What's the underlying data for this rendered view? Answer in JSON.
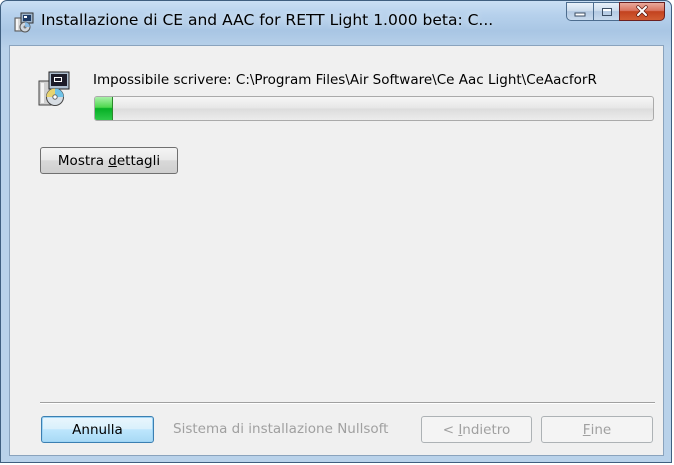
{
  "window": {
    "title": "Installazione di CE and AAC for RETT Light 1.000 beta: C...",
    "caption_buttons": {
      "minimize_icon": "minimize-icon",
      "maximize_icon": "maximize-icon",
      "close_icon": "close-icon"
    }
  },
  "main": {
    "status_text": "Impossibile scrivere: C:\\Program Files\\Air Software\\Ce Aac Light\\CeAacforR",
    "progress": {
      "value_percent": 3,
      "color": "#06b025"
    },
    "details_button": {
      "label_pre": "Mostra ",
      "label_accel": "d",
      "label_post": "ettagli"
    }
  },
  "footer": {
    "cancel_label": "Annulla",
    "branding_text": "Sistema di installazione Nullsoft",
    "back_button": {
      "label_pre": "< ",
      "label_accel": "I",
      "label_post": "ndietro"
    },
    "finish_button": {
      "label_pre": "",
      "label_accel": "F",
      "label_post": "ine"
    }
  },
  "colors": {
    "accent": "#3c7fb1",
    "close_red": "#c2421f",
    "disabled_text": "#a0a0a0"
  }
}
